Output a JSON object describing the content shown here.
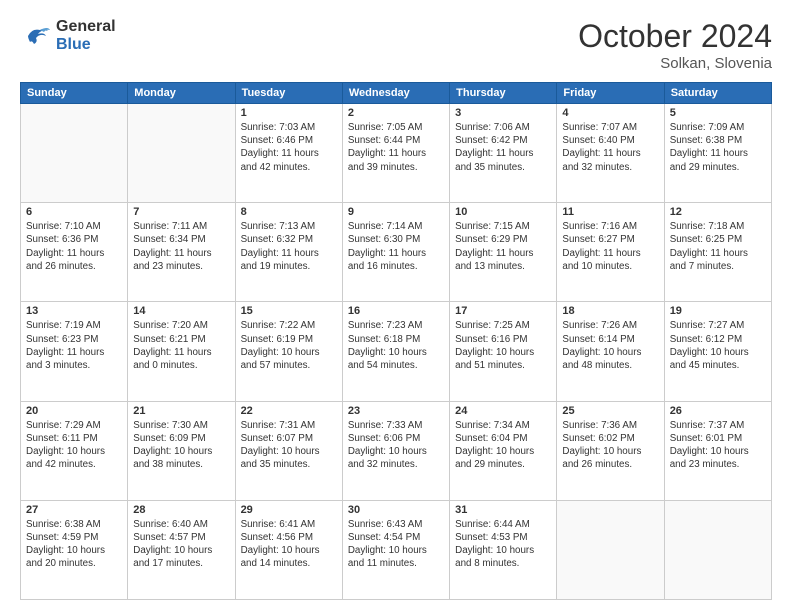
{
  "header": {
    "logo_line1": "General",
    "logo_line2": "Blue",
    "month": "October 2024",
    "location": "Solkan, Slovenia"
  },
  "days_of_week": [
    "Sunday",
    "Monday",
    "Tuesday",
    "Wednesday",
    "Thursday",
    "Friday",
    "Saturday"
  ],
  "weeks": [
    [
      {
        "day": "",
        "info": ""
      },
      {
        "day": "",
        "info": ""
      },
      {
        "day": "1",
        "info": "Sunrise: 7:03 AM\nSunset: 6:46 PM\nDaylight: 11 hours and 42 minutes."
      },
      {
        "day": "2",
        "info": "Sunrise: 7:05 AM\nSunset: 6:44 PM\nDaylight: 11 hours and 39 minutes."
      },
      {
        "day": "3",
        "info": "Sunrise: 7:06 AM\nSunset: 6:42 PM\nDaylight: 11 hours and 35 minutes."
      },
      {
        "day": "4",
        "info": "Sunrise: 7:07 AM\nSunset: 6:40 PM\nDaylight: 11 hours and 32 minutes."
      },
      {
        "day": "5",
        "info": "Sunrise: 7:09 AM\nSunset: 6:38 PM\nDaylight: 11 hours and 29 minutes."
      }
    ],
    [
      {
        "day": "6",
        "info": "Sunrise: 7:10 AM\nSunset: 6:36 PM\nDaylight: 11 hours and 26 minutes."
      },
      {
        "day": "7",
        "info": "Sunrise: 7:11 AM\nSunset: 6:34 PM\nDaylight: 11 hours and 23 minutes."
      },
      {
        "day": "8",
        "info": "Sunrise: 7:13 AM\nSunset: 6:32 PM\nDaylight: 11 hours and 19 minutes."
      },
      {
        "day": "9",
        "info": "Sunrise: 7:14 AM\nSunset: 6:30 PM\nDaylight: 11 hours and 16 minutes."
      },
      {
        "day": "10",
        "info": "Sunrise: 7:15 AM\nSunset: 6:29 PM\nDaylight: 11 hours and 13 minutes."
      },
      {
        "day": "11",
        "info": "Sunrise: 7:16 AM\nSunset: 6:27 PM\nDaylight: 11 hours and 10 minutes."
      },
      {
        "day": "12",
        "info": "Sunrise: 7:18 AM\nSunset: 6:25 PM\nDaylight: 11 hours and 7 minutes."
      }
    ],
    [
      {
        "day": "13",
        "info": "Sunrise: 7:19 AM\nSunset: 6:23 PM\nDaylight: 11 hours and 3 minutes."
      },
      {
        "day": "14",
        "info": "Sunrise: 7:20 AM\nSunset: 6:21 PM\nDaylight: 11 hours and 0 minutes."
      },
      {
        "day": "15",
        "info": "Sunrise: 7:22 AM\nSunset: 6:19 PM\nDaylight: 10 hours and 57 minutes."
      },
      {
        "day": "16",
        "info": "Sunrise: 7:23 AM\nSunset: 6:18 PM\nDaylight: 10 hours and 54 minutes."
      },
      {
        "day": "17",
        "info": "Sunrise: 7:25 AM\nSunset: 6:16 PM\nDaylight: 10 hours and 51 minutes."
      },
      {
        "day": "18",
        "info": "Sunrise: 7:26 AM\nSunset: 6:14 PM\nDaylight: 10 hours and 48 minutes."
      },
      {
        "day": "19",
        "info": "Sunrise: 7:27 AM\nSunset: 6:12 PM\nDaylight: 10 hours and 45 minutes."
      }
    ],
    [
      {
        "day": "20",
        "info": "Sunrise: 7:29 AM\nSunset: 6:11 PM\nDaylight: 10 hours and 42 minutes."
      },
      {
        "day": "21",
        "info": "Sunrise: 7:30 AM\nSunset: 6:09 PM\nDaylight: 10 hours and 38 minutes."
      },
      {
        "day": "22",
        "info": "Sunrise: 7:31 AM\nSunset: 6:07 PM\nDaylight: 10 hours and 35 minutes."
      },
      {
        "day": "23",
        "info": "Sunrise: 7:33 AM\nSunset: 6:06 PM\nDaylight: 10 hours and 32 minutes."
      },
      {
        "day": "24",
        "info": "Sunrise: 7:34 AM\nSunset: 6:04 PM\nDaylight: 10 hours and 29 minutes."
      },
      {
        "day": "25",
        "info": "Sunrise: 7:36 AM\nSunset: 6:02 PM\nDaylight: 10 hours and 26 minutes."
      },
      {
        "day": "26",
        "info": "Sunrise: 7:37 AM\nSunset: 6:01 PM\nDaylight: 10 hours and 23 minutes."
      }
    ],
    [
      {
        "day": "27",
        "info": "Sunrise: 6:38 AM\nSunset: 4:59 PM\nDaylight: 10 hours and 20 minutes."
      },
      {
        "day": "28",
        "info": "Sunrise: 6:40 AM\nSunset: 4:57 PM\nDaylight: 10 hours and 17 minutes."
      },
      {
        "day": "29",
        "info": "Sunrise: 6:41 AM\nSunset: 4:56 PM\nDaylight: 10 hours and 14 minutes."
      },
      {
        "day": "30",
        "info": "Sunrise: 6:43 AM\nSunset: 4:54 PM\nDaylight: 10 hours and 11 minutes."
      },
      {
        "day": "31",
        "info": "Sunrise: 6:44 AM\nSunset: 4:53 PM\nDaylight: 10 hours and 8 minutes."
      },
      {
        "day": "",
        "info": ""
      },
      {
        "day": "",
        "info": ""
      }
    ]
  ]
}
